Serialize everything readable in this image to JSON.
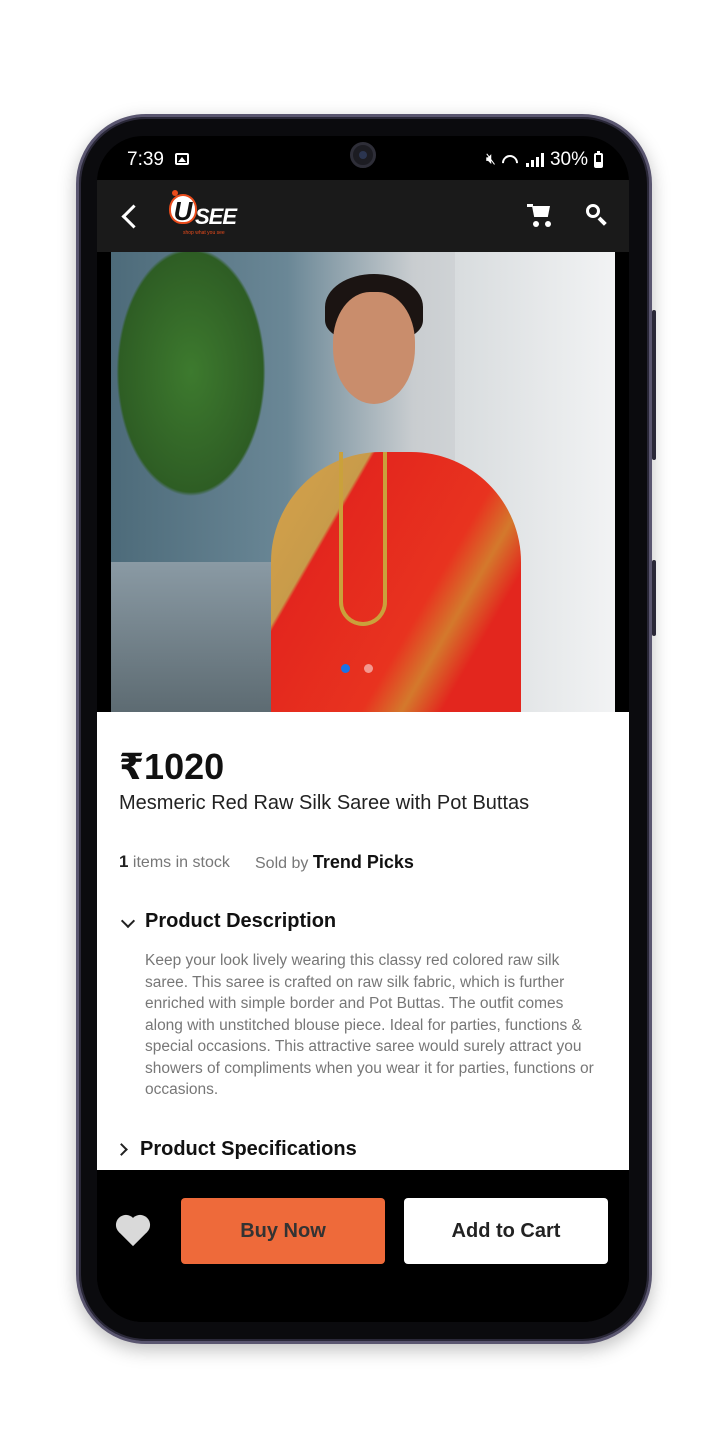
{
  "status_bar": {
    "time": "7:39",
    "battery": "30%"
  },
  "app_bar": {
    "logo_text": "SEE",
    "logo_badge": "U",
    "logo_tagline": "shop what you see",
    "icons": [
      "back-arrow-icon",
      "cart-icon",
      "search-icon"
    ]
  },
  "carousel": {
    "slides": 2,
    "active": 0
  },
  "product": {
    "price": "₹1020",
    "title": "Mesmeric Red Raw Silk Saree with Pot Buttas",
    "stock_count": "1",
    "stock_label": "items in stock",
    "sold_by_label": "Sold by",
    "seller": "Trend Picks",
    "description_header": "Product Description",
    "description": "Keep your look lively wearing this classy red colored raw silk saree. This saree is crafted on raw silk fabric, which is further enriched with simple border and Pot Buttas. The outfit comes along with unstitched blouse piece. Ideal for parties, functions & special occasions. This attractive saree would surely attract you showers of compliments when you wear it for parties, functions or occasions.",
    "specifications_header": "Product Specifications"
  },
  "actions": {
    "buy_now": "Buy Now",
    "add_to_cart": "Add to Cart"
  },
  "colors": {
    "accent": "#ee6a3a",
    "appbar": "#1a1a1a",
    "active_dot": "#1a73e8"
  }
}
